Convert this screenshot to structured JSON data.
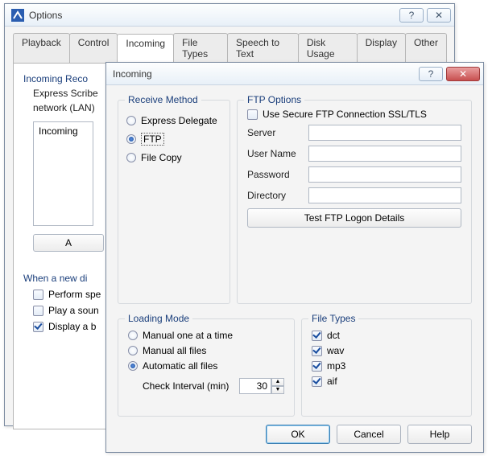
{
  "options_window": {
    "title": "Options",
    "tabs": [
      "Playback",
      "Control",
      "Incoming",
      "File Types",
      "Speech to Text",
      "Disk Usage",
      "Display",
      "Other"
    ],
    "active_tab": "Incoming",
    "section_title": "Incoming Reco",
    "description_line1": "Express Scribe",
    "description_line2": "network (LAN)",
    "listbox_item": "Incoming",
    "add_button": "A",
    "when_new_label": "When a new di",
    "perform_checkbox": {
      "label": "Perform spe",
      "checked": false
    },
    "play_checkbox": {
      "label": "Play a soun",
      "checked": false
    },
    "display_checkbox": {
      "label": "Display a b",
      "checked": true
    }
  },
  "incoming_dialog": {
    "title": "Incoming",
    "receive_method": {
      "legend": "Receive Method",
      "options": {
        "express_delegate": {
          "label": "Express Delegate",
          "selected": false
        },
        "ftp": {
          "label": "FTP",
          "selected": true
        },
        "file_copy": {
          "label": "File Copy",
          "selected": false
        }
      }
    },
    "ftp_options": {
      "legend": "FTP Options",
      "secure_checkbox": {
        "label": "Use Secure FTP Connection SSL/TLS",
        "checked": false
      },
      "server_label": "Server",
      "server_value": "",
      "username_label": "User Name",
      "username_value": "",
      "password_label": "Password",
      "password_value": "",
      "directory_label": "Directory",
      "directory_value": "",
      "test_button": "Test FTP Logon Details"
    },
    "loading_mode": {
      "legend": "Loading Mode",
      "options": {
        "manual_one": {
          "label": "Manual one at a time",
          "selected": false
        },
        "manual_all": {
          "label": "Manual all files",
          "selected": false
        },
        "auto_all": {
          "label": "Automatic all files",
          "selected": true
        }
      },
      "interval_label": "Check Interval (min)",
      "interval_value": "30"
    },
    "file_types": {
      "legend": "File Types",
      "items": {
        "dct": {
          "label": "dct",
          "checked": true
        },
        "wav": {
          "label": "wav",
          "checked": true
        },
        "mp3": {
          "label": "mp3",
          "checked": true
        },
        "aif": {
          "label": "aif",
          "checked": true
        }
      }
    },
    "buttons": {
      "ok": "OK",
      "cancel": "Cancel",
      "help": "Help"
    }
  }
}
